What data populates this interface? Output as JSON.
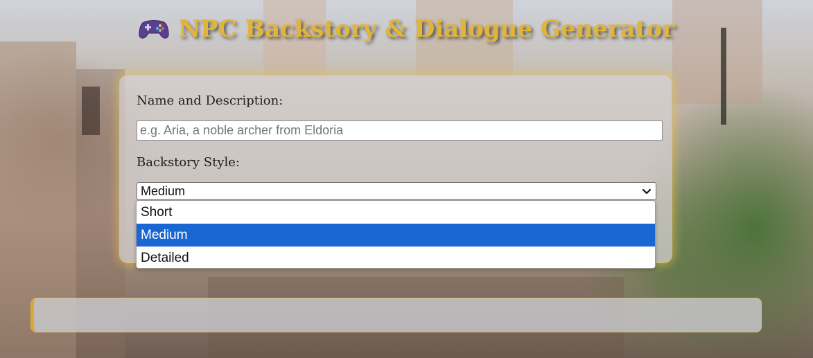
{
  "header": {
    "title": "NPC Backstory & Dialogue Generator",
    "icon": "gamepad-icon"
  },
  "form": {
    "name_label": "Name and Description:",
    "name_placeholder": "e.g. Aria, a noble archer from Eldoria",
    "name_value": "",
    "style_label": "Backstory Style:",
    "style_selected": "Medium",
    "style_options": [
      "Short",
      "Medium",
      "Detailed"
    ]
  },
  "colors": {
    "title": "#e1b53a",
    "accent_border": "#d9a935",
    "option_highlight": "#1a66d2"
  }
}
